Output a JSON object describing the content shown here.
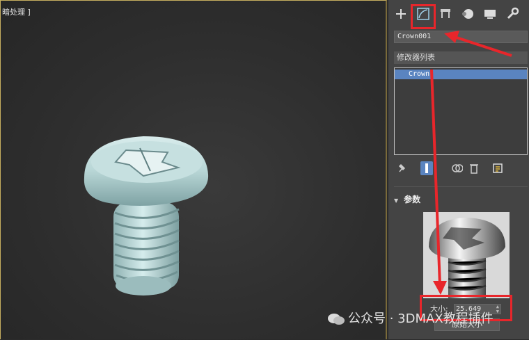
{
  "viewport": {
    "label": "暗处理 ]"
  },
  "panel": {
    "tabs": [
      {
        "name": "create",
        "icon": "plus-icon"
      },
      {
        "name": "modify",
        "icon": "modify-icon",
        "active": true
      },
      {
        "name": "hierarchy",
        "icon": "hierarchy-icon"
      },
      {
        "name": "motion",
        "icon": "motion-icon"
      },
      {
        "name": "display",
        "icon": "display-icon"
      },
      {
        "name": "utilities",
        "icon": "wrench-icon"
      }
    ],
    "object_name": "Crown001",
    "modifier_list_label": "修改器列表",
    "stack_items": [
      "Crown"
    ],
    "params_title": "参数",
    "size_label": "大小:",
    "size_value": "25.649",
    "reset_button": "原始大小"
  },
  "watermark": {
    "text": "公众号 · 3DMAX教程插件"
  },
  "colors": {
    "highlight": "#e8262b",
    "selection": "#5a84c0",
    "panel_bg": "#444444"
  }
}
